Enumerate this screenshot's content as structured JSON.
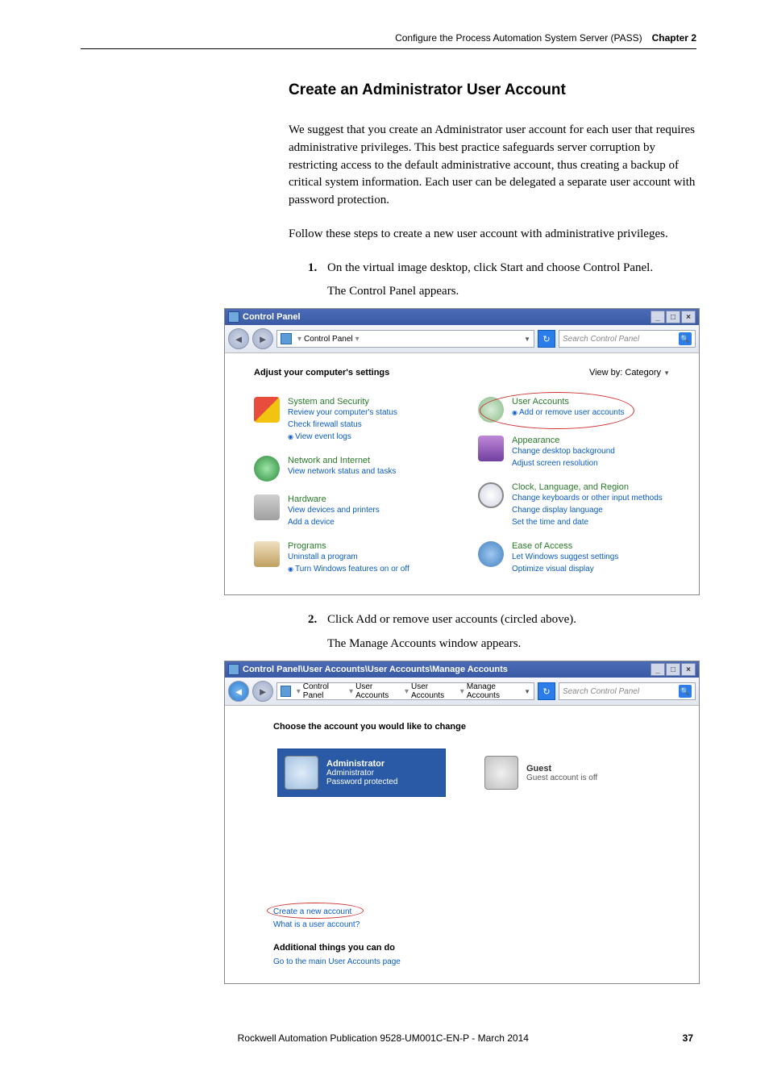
{
  "page_header": {
    "doc_title": "Configure the Process Automation System Server (PASS)",
    "chapter": "Chapter 2"
  },
  "section_title": "Create an Administrator User Account",
  "para1": "We suggest that you create an Administrator user account for each user that requires administrative privileges. This best practice safeguards server corruption by restricting access to the default administrative account, thus creating a backup of critical system information. Each user can be delegated a separate user account with password protection.",
  "para2": "Follow these steps to create a new user account with administrative privileges.",
  "step1_num": "1.",
  "step1_text": "On the virtual image desktop, click Start and choose Control Panel.",
  "step1_after": "The Control Panel appears.",
  "step2_num": "2.",
  "step2_text": "Click Add or remove user accounts (circled above).",
  "step2_after": "The Manage Accounts window appears.",
  "cp_window": {
    "title": "Control Panel",
    "breadcrumb": "Control Panel",
    "search_placeholder": "Search Control Panel",
    "adjust": "Adjust your computer's settings",
    "viewby_label": "View by:",
    "viewby_value": "Category",
    "left": [
      {
        "title": "System and Security",
        "links": [
          "Review your computer's status",
          "Check firewall status",
          "View event logs"
        ],
        "iconlink_idx": 2,
        "icon": "shield"
      },
      {
        "title": "Network and Internet",
        "links": [
          "View network status and tasks"
        ],
        "icon": "globe"
      },
      {
        "title": "Hardware",
        "links": [
          "View devices and printers",
          "Add a device"
        ],
        "icon": "hw"
      },
      {
        "title": "Programs",
        "links": [
          "Uninstall a program",
          "Turn Windows features on or off"
        ],
        "iconlink_idx": 1,
        "icon": "prog"
      }
    ],
    "right": [
      {
        "title": "User Accounts",
        "links": [
          "Add or remove user accounts"
        ],
        "iconlink_idx": 0,
        "icon": "user",
        "circled": true
      },
      {
        "title": "Appearance",
        "links": [
          "Change desktop background",
          "Adjust screen resolution"
        ],
        "icon": "appear"
      },
      {
        "title": "Clock, Language, and Region",
        "links": [
          "Change keyboards or other input methods",
          "Change display language",
          "Set the time and date"
        ],
        "icon": "clock"
      },
      {
        "title": "Ease of Access",
        "links": [
          "Let Windows suggest settings",
          "Optimize visual display"
        ],
        "icon": "ease"
      }
    ]
  },
  "ma_window": {
    "title": "Control Panel\\User Accounts\\User Accounts\\Manage Accounts",
    "breadcrumb": [
      "Control Panel",
      "User Accounts",
      "User Accounts",
      "Manage Accounts"
    ],
    "search_placeholder": "Search Control Panel",
    "heading": "Choose the account you would like to change",
    "admin_tile": {
      "name": "Administrator",
      "role": "Administrator",
      "pw": "Password protected"
    },
    "guest_tile": {
      "name": "Guest",
      "sub": "Guest account is off"
    },
    "link_create": "Create a new account",
    "link_what": "What is a user account?",
    "subheading": "Additional things you can do",
    "link_main": "Go to the main User Accounts page"
  },
  "footer": {
    "pub": "Rockwell Automation Publication 9528-UM001C-EN-P - March 2014",
    "page": "37"
  }
}
